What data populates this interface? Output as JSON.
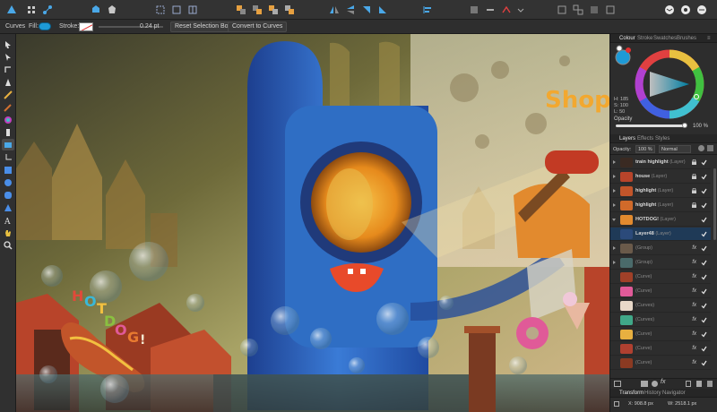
{
  "context_toolbar": {
    "tool_name": "Curves",
    "fill_label": "Fill:",
    "stroke_label": "Stroke:",
    "stroke_width": "0.24 pt",
    "reset_selection_box": "Reset Selection Box",
    "convert_to_curves": "Convert to Curves"
  },
  "panel_tabs": [
    "Colour",
    "Stroke",
    "Swatches",
    "Brushes"
  ],
  "colour": {
    "h": "H: 185",
    "s": "S: 100",
    "l": "L: 50",
    "opacity_label": "Opacity",
    "opacity_value": "100 %"
  },
  "layers_tabs": [
    "Layers",
    "Effects",
    "Styles"
  ],
  "layers_controls": {
    "opacity_label": "Opacity:",
    "opacity_value": "100 %",
    "blend_mode": "Normal"
  },
  "layers": [
    {
      "name": "train highlight",
      "type": "(Layer)",
      "lock": true,
      "fx": false,
      "expand": "closed",
      "selected": false
    },
    {
      "name": "house",
      "type": "(Layer)",
      "lock": true,
      "fx": false,
      "expand": "closed",
      "selected": false
    },
    {
      "name": "highlight",
      "type": "(Layer)",
      "lock": true,
      "fx": false,
      "expand": "closed",
      "selected": false
    },
    {
      "name": "highlight",
      "type": "(Layer)",
      "lock": true,
      "fx": false,
      "expand": "closed",
      "selected": false
    },
    {
      "name": "HOTDOG!",
      "type": "(Layer)",
      "lock": false,
      "fx": false,
      "expand": "open",
      "selected": false
    },
    {
      "name": "Layer48",
      "type": "(Layer)",
      "lock": false,
      "fx": false,
      "expand": "none",
      "selected": true
    },
    {
      "name": "",
      "type": "(Group)",
      "lock": false,
      "fx": true,
      "expand": "closed",
      "selected": false
    },
    {
      "name": "",
      "type": "(Group)",
      "lock": false,
      "fx": true,
      "expand": "closed",
      "selected": false
    },
    {
      "name": "",
      "type": "(Curve)",
      "lock": false,
      "fx": true,
      "expand": "none",
      "selected": false
    },
    {
      "name": "",
      "type": "(Curve)",
      "lock": false,
      "fx": true,
      "expand": "none",
      "selected": false
    },
    {
      "name": "",
      "type": "(Curves)",
      "lock": false,
      "fx": true,
      "expand": "none",
      "selected": false
    },
    {
      "name": "",
      "type": "(Curves)",
      "lock": false,
      "fx": true,
      "expand": "none",
      "selected": false
    },
    {
      "name": "",
      "type": "(Curve)",
      "lock": false,
      "fx": true,
      "expand": "none",
      "selected": false
    },
    {
      "name": "",
      "type": "(Curve)",
      "lock": false,
      "fx": true,
      "expand": "none",
      "selected": false
    },
    {
      "name": "",
      "type": "(Curve)",
      "lock": false,
      "fx": true,
      "expand": "none",
      "selected": false
    }
  ],
  "bottom_tabs": [
    "Transform",
    "History",
    "Navigator"
  ],
  "transform": {
    "x": "X: 908.8 px",
    "w": "W: 2518.1 px"
  },
  "artwork_text": {
    "shop_sign": "Shop",
    "hotdog_letters": [
      "H",
      "O",
      "T",
      "D",
      "O",
      "G",
      "!"
    ]
  },
  "colors": {
    "accent": "#1e9ad6",
    "selection": "#1f3a57"
  }
}
